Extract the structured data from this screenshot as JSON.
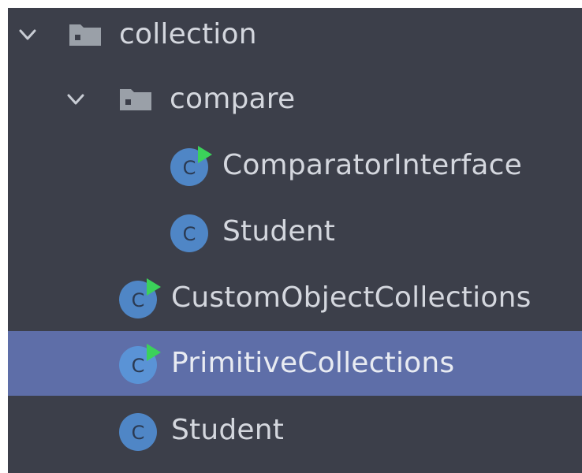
{
  "colors": {
    "panel_bg": "#3c3f4a",
    "selection_bg": "#5e6ea8",
    "text": "#d4d7de",
    "class_icon": "#4f86c6",
    "run_marker": "#3bd15a",
    "folder_icon": "#9aa0a8"
  },
  "tree": {
    "items": [
      {
        "label": "collection",
        "kind": "folder",
        "expanded": true,
        "icon": "folder-icon",
        "chevron": "chevron-down-icon"
      },
      {
        "label": "compare",
        "kind": "folder",
        "expanded": true,
        "icon": "folder-icon",
        "chevron": "chevron-down-icon"
      },
      {
        "label": "ComparatorInterface",
        "kind": "class",
        "runnable": true,
        "icon": "java-class-runnable-icon"
      },
      {
        "label": "Student",
        "kind": "class",
        "runnable": false,
        "icon": "java-class-icon"
      },
      {
        "label": "CustomObjectCollections",
        "kind": "class",
        "runnable": true,
        "icon": "java-class-runnable-icon"
      },
      {
        "label": "PrimitiveCollections",
        "kind": "class",
        "runnable": true,
        "selected": true,
        "icon": "java-class-runnable-icon"
      },
      {
        "label": "Student",
        "kind": "class",
        "runnable": false,
        "icon": "java-class-icon"
      }
    ],
    "class_icon_letter": "C"
  }
}
